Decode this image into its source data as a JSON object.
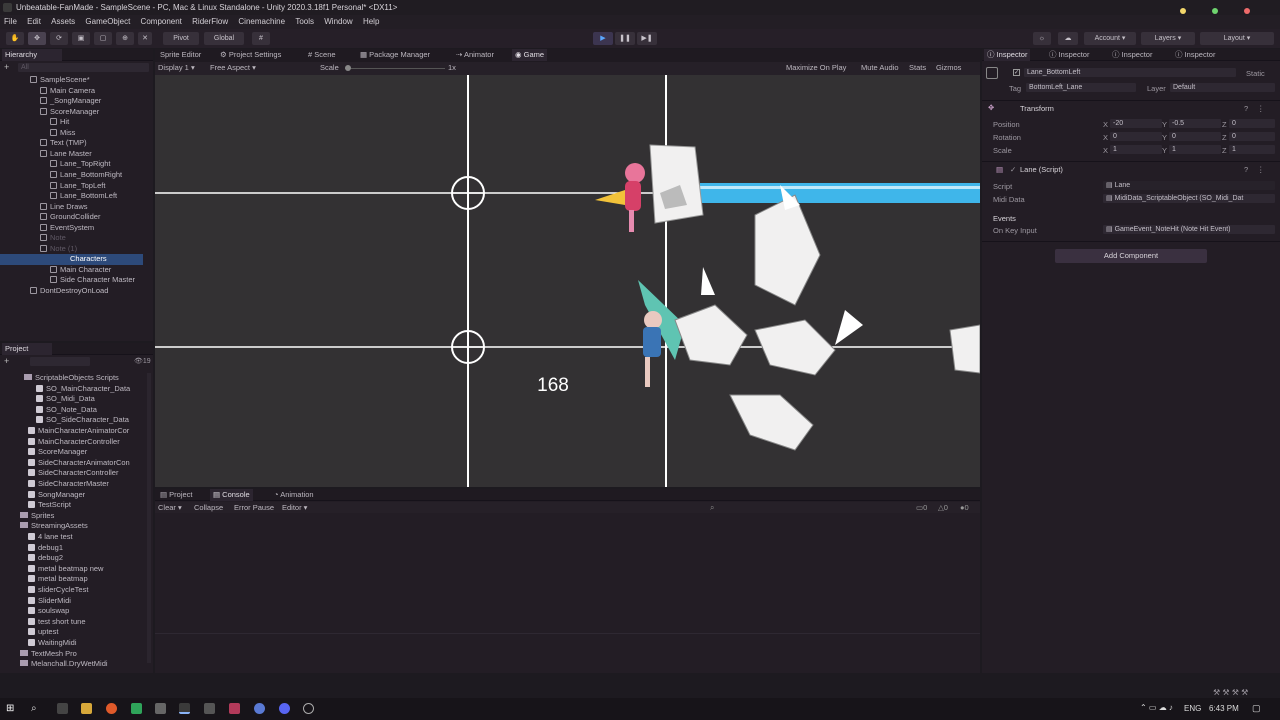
{
  "window": {
    "title": "Unbeatable-FanMade - SampleScene - PC, Mac & Linux Standalone - Unity 2020.3.18f1 Personal* <DX11>"
  },
  "menu": [
    "File",
    "Edit",
    "Assets",
    "GameObject",
    "Component",
    "RiderFlow",
    "Cinemachine",
    "Tools",
    "Window",
    "Help"
  ],
  "toolbar": {
    "pivot": "Pivot",
    "global": "Global",
    "account": "Account",
    "layers": "Layers",
    "layout": "Layout"
  },
  "hierarchy": {
    "tab": "Hierarchy",
    "search_placeholder": "All",
    "items": [
      {
        "label": "SampleScene*",
        "type": "scene"
      },
      {
        "label": "Main Camera",
        "type": "obj"
      },
      {
        "label": "_SongManager",
        "type": "obj"
      },
      {
        "label": "ScoreManager",
        "type": "obj"
      },
      {
        "label": "Hit",
        "type": "obj"
      },
      {
        "label": "Miss",
        "type": "obj"
      },
      {
        "label": "Text (TMP)",
        "type": "obj"
      },
      {
        "label": "Lane Master",
        "type": "obj"
      },
      {
        "label": "Lane_TopRight",
        "type": "obj"
      },
      {
        "label": "Lane_BottomRight",
        "type": "obj"
      },
      {
        "label": "Lane_TopLeft",
        "type": "obj"
      },
      {
        "label": "Lane_BottomLeft",
        "type": "obj"
      },
      {
        "label": "Line Draws",
        "type": "obj"
      },
      {
        "label": "GroundCollider",
        "type": "obj"
      },
      {
        "label": "EventSystem",
        "type": "obj"
      },
      {
        "label": "Note",
        "type": "dim"
      },
      {
        "label": "Note (1)",
        "type": "dim"
      },
      {
        "label": "Characters",
        "type": "sel"
      },
      {
        "label": "Main Character",
        "type": "obj"
      },
      {
        "label": "Side Character Master",
        "type": "obj"
      },
      {
        "label": "DontDestroyOnLoad",
        "type": "scene"
      }
    ]
  },
  "project": {
    "tab": "Project",
    "count": "19",
    "items": [
      {
        "label": "ScriptableObjects Scripts",
        "type": "folder"
      },
      {
        "label": "SO_MainCharacter_Data",
        "type": "script"
      },
      {
        "label": "SO_Midi_Data",
        "type": "script"
      },
      {
        "label": "SO_Note_Data",
        "type": "script"
      },
      {
        "label": "SO_SideCharacter_Data",
        "type": "script"
      },
      {
        "label": "MainCharacterAnimatorCor",
        "type": "script"
      },
      {
        "label": "MainCharacterController",
        "type": "script"
      },
      {
        "label": "ScoreManager",
        "type": "script"
      },
      {
        "label": "SideCharacterAnimatorCon",
        "type": "script"
      },
      {
        "label": "SideCharacterController",
        "type": "script"
      },
      {
        "label": "SideCharacterMaster",
        "type": "script"
      },
      {
        "label": "SongManager",
        "type": "script"
      },
      {
        "label": "TestScript",
        "type": "script"
      },
      {
        "label": "Sprites",
        "type": "folder"
      },
      {
        "label": "StreamingAssets",
        "type": "folder"
      },
      {
        "label": "4 lane test",
        "type": "script"
      },
      {
        "label": "debug1",
        "type": "script"
      },
      {
        "label": "debug2",
        "type": "script"
      },
      {
        "label": "metal beatmap new",
        "type": "script"
      },
      {
        "label": "metal beatmap",
        "type": "script"
      },
      {
        "label": "sliderCycleTest",
        "type": "script"
      },
      {
        "label": "SliderMidi",
        "type": "script"
      },
      {
        "label": "soulswap",
        "type": "script"
      },
      {
        "label": "test short tune",
        "type": "script"
      },
      {
        "label": "uptest",
        "type": "script"
      },
      {
        "label": "WaitingMidi",
        "type": "script"
      },
      {
        "label": "TextMesh Pro",
        "type": "folder"
      },
      {
        "label": "Melanchall.DryWetMidi",
        "type": "folder"
      }
    ]
  },
  "scene_tabs": [
    "Sprite Editor",
    "Project Settings",
    "Scene",
    "Package Manager",
    "Animator",
    "Game"
  ],
  "game_toolbar": {
    "display": "Display 1",
    "aspect": "Free Aspect",
    "scale_label": "Scale",
    "scale_value": "1x",
    "maximize": "Maximize On Play",
    "mute": "Mute Audio",
    "stats": "Stats",
    "gizmos": "Gizmos"
  },
  "game": {
    "score": "168"
  },
  "console": {
    "tabs": [
      "Project",
      "Console",
      "Animation"
    ],
    "clear": "Clear",
    "collapse": "Collapse",
    "error_pause": "Error Pause",
    "editor": "Editor",
    "count_logs": "0",
    "count_warn": "0",
    "count_err": "0"
  },
  "inspector": {
    "tabs": [
      "Inspector",
      "Inspector",
      "Inspector",
      "Inspector"
    ],
    "object_name": "Lane_BottomLeft",
    "static": "Static",
    "tag_label": "Tag",
    "tag_value": "BottomLeft_Lane",
    "layer_label": "Layer",
    "layer_value": "Default",
    "transform": {
      "title": "Transform",
      "position": {
        "label": "Position",
        "x": "-20",
        "y": "-0.5",
        "z": "0"
      },
      "rotation": {
        "label": "Rotation",
        "x": "0",
        "y": "0",
        "z": "0"
      },
      "scale": {
        "label": "Scale",
        "x": "1",
        "y": "1",
        "z": "1"
      }
    },
    "lane_script": {
      "title": "Lane (Script)",
      "script_label": "Script",
      "script_value": "Lane",
      "midi_label": "Midi Data",
      "midi_value": "MidiData_ScriptableObject (SO_Midi_Dat",
      "events_label": "Events",
      "onkey_label": "On Key Input",
      "onkey_value": "GameEvent_NoteHit (Note Hit Event)"
    },
    "add_component": "Add Component"
  },
  "taskbar": {
    "lang": "ENG",
    "time": "6:43 PM"
  },
  "colors": {
    "accent_blue": "#3fb6ea",
    "selection": "#2d4a7a",
    "bg": "#1d1a20"
  }
}
